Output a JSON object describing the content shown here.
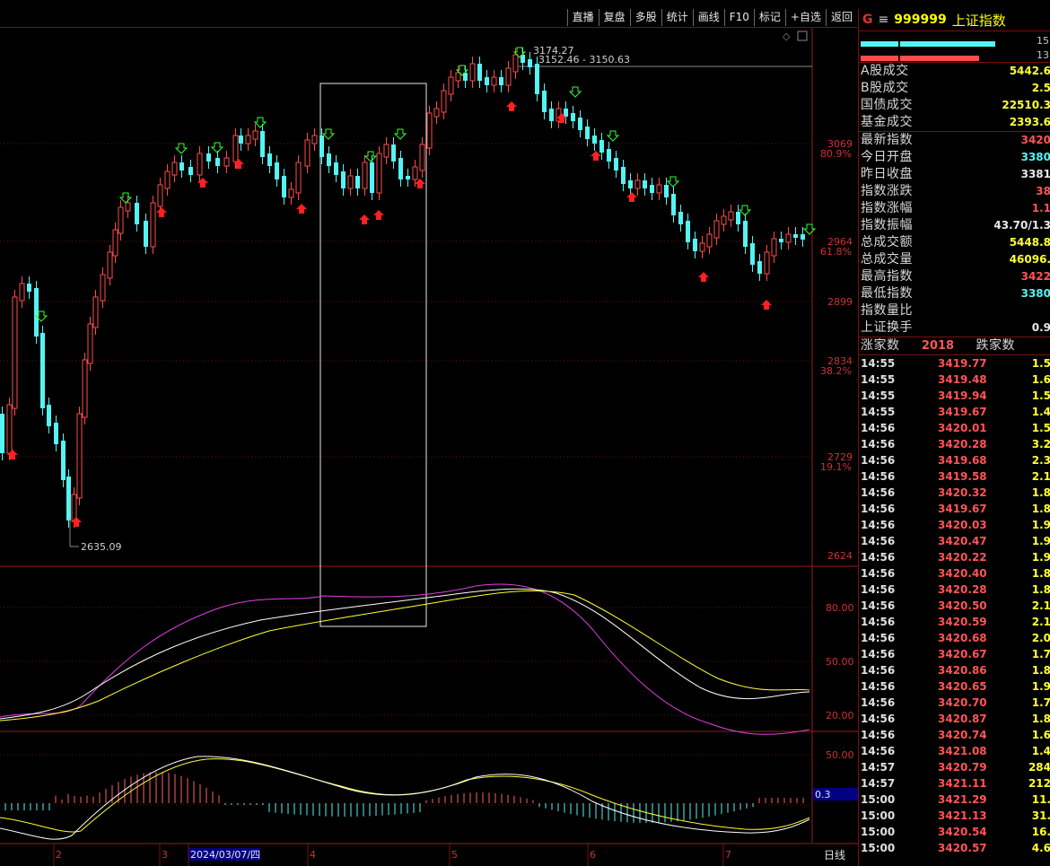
{
  "toolbar": {
    "buttons": [
      "直播",
      "复盘",
      "多股",
      "统计",
      "画线",
      "F10",
      "标记",
      "+自选",
      "返回"
    ]
  },
  "chart": {
    "price_axis": [
      {
        "value": "3069",
        "pct": "80.9%"
      },
      {
        "value": "2964",
        "pct": "61.8%"
      },
      {
        "value": "2899",
        "pct": ""
      },
      {
        "value": "2834",
        "pct": "38.2%"
      },
      {
        "value": "2729",
        "pct": "19.1%"
      },
      {
        "value": "2624",
        "pct": ""
      }
    ],
    "annotations": {
      "high": "3174.27",
      "high_range": "3152.46 - 3150.63",
      "low": "2635.09"
    },
    "kdj_axis": [
      "80.00",
      "50.00",
      "20.00"
    ],
    "macd_axis": [
      "50.00"
    ],
    "macd_value": "0.3",
    "date_axis": [
      "2",
      "3",
      "2024/03/07/四",
      "4",
      "5",
      "6",
      "7"
    ],
    "period_label": "日线"
  },
  "panel": {
    "g": "G",
    "menu": "≡",
    "code": "999999",
    "name": "上证指数",
    "bar_top_num": "15",
    "bar_bottom_num": "13",
    "group1": [
      {
        "k": "A股成交",
        "v": "5442.6",
        "c": "yellow"
      },
      {
        "k": "B股成交",
        "v": "2.5",
        "c": "yellow"
      },
      {
        "k": "国债成交",
        "v": "22510.3",
        "c": "yellow"
      },
      {
        "k": "基金成交",
        "v": "2393.6",
        "c": "yellow"
      }
    ],
    "group2": [
      {
        "k": "最新指数",
        "v": "3420",
        "c": "red"
      },
      {
        "k": "今日开盘",
        "v": "3380",
        "c": "cyan"
      },
      {
        "k": "昨日收盘",
        "v": "3381",
        "c": "white"
      },
      {
        "k": "指数涨跌",
        "v": "38",
        "c": "red"
      },
      {
        "k": "指数涨幅",
        "v": "1.1",
        "c": "red"
      },
      {
        "k": "指数振幅",
        "v": "43.70/1.3",
        "c": "white"
      },
      {
        "k": "总成交额",
        "v": "5448.8",
        "c": "yellow"
      },
      {
        "k": "总成交量",
        "v": "46096.",
        "c": "yellow"
      },
      {
        "k": "最高指数",
        "v": "3422",
        "c": "red"
      },
      {
        "k": "最低指数",
        "v": "3380",
        "c": "cyan"
      },
      {
        "k": "指数量比",
        "v": "",
        "c": "white"
      },
      {
        "k": "上证换手",
        "v": "0.9",
        "c": "white"
      }
    ],
    "breadth": {
      "up_label": "涨家数",
      "up_value": "2018",
      "down_label": "跌家数"
    },
    "ticks": [
      {
        "t": "14:55",
        "p": "3419.77",
        "v": "1.5",
        "c": "yellow"
      },
      {
        "t": "14:55",
        "p": "3419.48",
        "v": "1.6",
        "c": "yellow"
      },
      {
        "t": "14:55",
        "p": "3419.94",
        "v": "1.5",
        "c": "yellow"
      },
      {
        "t": "14:55",
        "p": "3419.67",
        "v": "1.4",
        "c": "yellow"
      },
      {
        "t": "14:56",
        "p": "3420.01",
        "v": "1.5",
        "c": "yellow"
      },
      {
        "t": "14:56",
        "p": "3420.28",
        "v": "3.2",
        "c": "yellow"
      },
      {
        "t": "14:56",
        "p": "3419.68",
        "v": "2.3",
        "c": "yellow"
      },
      {
        "t": "14:56",
        "p": "3419.58",
        "v": "2.1",
        "c": "yellow"
      },
      {
        "t": "14:56",
        "p": "3420.32",
        "v": "1.8",
        "c": "yellow"
      },
      {
        "t": "14:56",
        "p": "3419.67",
        "v": "1.8",
        "c": "yellow"
      },
      {
        "t": "14:56",
        "p": "3420.03",
        "v": "1.9",
        "c": "yellow"
      },
      {
        "t": "14:56",
        "p": "3420.47",
        "v": "1.9",
        "c": "yellow"
      },
      {
        "t": "14:56",
        "p": "3420.22",
        "v": "1.9",
        "c": "yellow"
      },
      {
        "t": "14:56",
        "p": "3420.40",
        "v": "1.8",
        "c": "yellow"
      },
      {
        "t": "14:56",
        "p": "3420.28",
        "v": "1.8",
        "c": "yellow"
      },
      {
        "t": "14:56",
        "p": "3420.50",
        "v": "2.1",
        "c": "yellow"
      },
      {
        "t": "14:56",
        "p": "3420.59",
        "v": "2.1",
        "c": "yellow"
      },
      {
        "t": "14:56",
        "p": "3420.68",
        "v": "2.0",
        "c": "yellow"
      },
      {
        "t": "14:56",
        "p": "3420.67",
        "v": "1.7",
        "c": "yellow"
      },
      {
        "t": "14:56",
        "p": "3420.86",
        "v": "1.8",
        "c": "yellow"
      },
      {
        "t": "14:56",
        "p": "3420.65",
        "v": "1.9",
        "c": "yellow"
      },
      {
        "t": "14:56",
        "p": "3420.70",
        "v": "1.7",
        "c": "yellow"
      },
      {
        "t": "14:56",
        "p": "3420.87",
        "v": "1.8",
        "c": "yellow"
      },
      {
        "t": "14:56",
        "p": "3420.74",
        "v": "1.6",
        "c": "yellow"
      },
      {
        "t": "14:56",
        "p": "3421.08",
        "v": "1.4",
        "c": "yellow"
      },
      {
        "t": "14:57",
        "p": "3420.79",
        "v": "284",
        "c": "yellow"
      },
      {
        "t": "14:57",
        "p": "3421.11",
        "v": "212",
        "c": "yellow"
      },
      {
        "t": "15:00",
        "p": "3421.29",
        "v": "11.",
        "c": "yellow"
      },
      {
        "t": "15:00",
        "p": "3421.13",
        "v": "31.",
        "c": "yellow"
      },
      {
        "t": "15:00",
        "p": "3420.54",
        "v": "16.",
        "c": "yellow"
      },
      {
        "t": "15:00",
        "p": "3420.57",
        "v": "4.6",
        "c": "yellow"
      }
    ]
  }
}
